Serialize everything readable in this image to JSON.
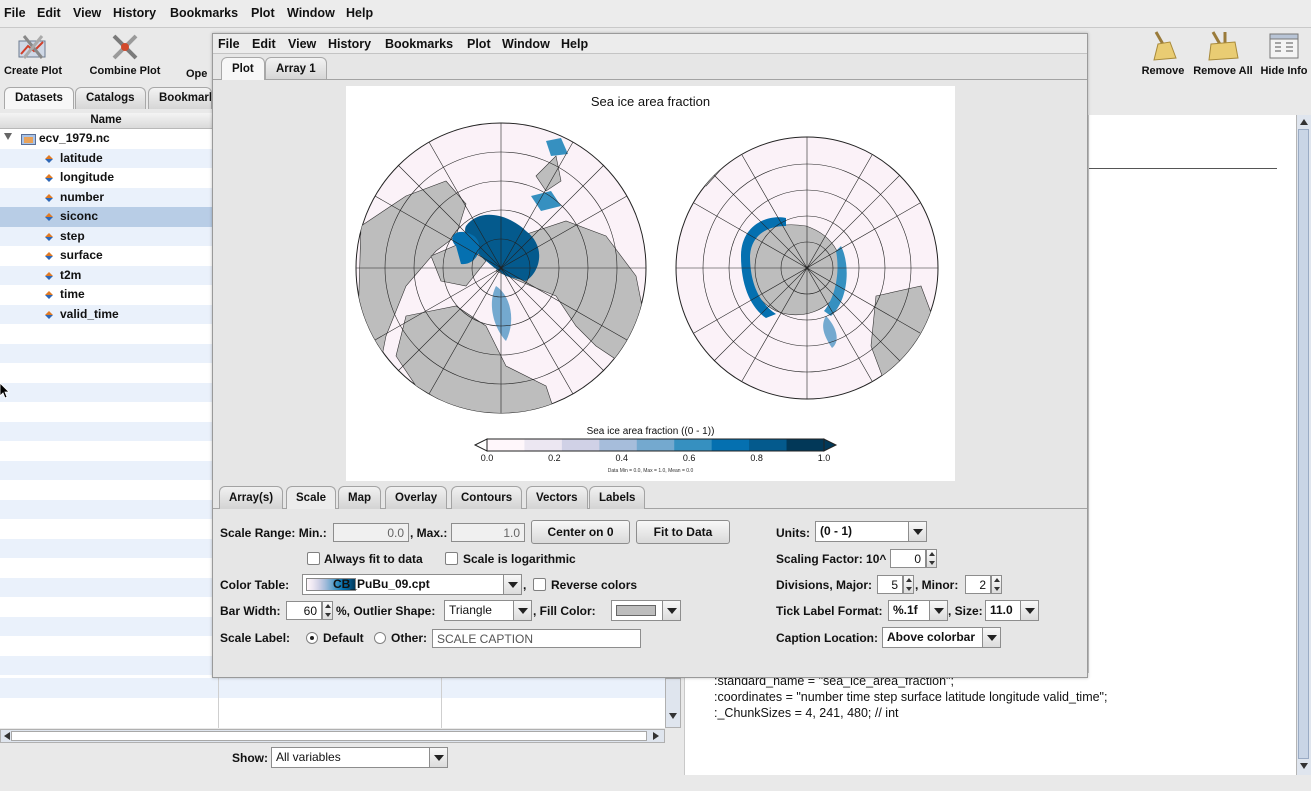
{
  "menubar": [
    "File",
    "Edit",
    "View",
    "History",
    "Bookmarks",
    "Plot",
    "Window",
    "Help"
  ],
  "toolbar": {
    "create_plot": "Create Plot",
    "combine_plot": "Combine Plot",
    "open": "Ope",
    "remove": "Remove",
    "remove_all": "Remove All",
    "hide_info": "Hide Info"
  },
  "left_tabs": [
    "Datasets",
    "Catalogs",
    "Bookmarks"
  ],
  "tree": {
    "column_header": "Name",
    "file": "ecv_1979.nc",
    "variables": [
      "latitude",
      "longitude",
      "number",
      "siconc",
      "step",
      "surface",
      "t2m",
      "time",
      "valid_time"
    ],
    "selected": "siconc"
  },
  "show": {
    "label": "Show:",
    "value": "All variables"
  },
  "info_lines": [
    ":standard_name = \"sea_ice_area_fraction\";",
    ":coordinates = \"number time step surface latitude longitude valid_time\";",
    ":_ChunkSizes = 4, 241, 480; // int"
  ],
  "plot_window": {
    "menubar": [
      "File",
      "Edit",
      "View",
      "History",
      "Bookmarks",
      "Plot",
      "Window",
      "Help"
    ],
    "tabs": [
      "Plot",
      "Array 1"
    ],
    "plot": {
      "title": "Sea ice area fraction",
      "colorbar_label": "Sea ice area fraction ((0 - 1))",
      "colorbar_ticks": [
        "0.0",
        "0.2",
        "0.4",
        "0.6",
        "0.8",
        "1.0"
      ],
      "colorbar_stats": "Data Min = 0.0, Max = 1.0, Mean = 0.0",
      "colors": [
        "#fff7fb",
        "#ece7f2",
        "#d0d1e6",
        "#a6bddb",
        "#74a9cf",
        "#3690c0",
        "#0570b0",
        "#045a8d",
        "#023858"
      ]
    },
    "bottom_tabs": [
      "Array(s)",
      "Scale",
      "Map",
      "Overlay",
      "Contours",
      "Vectors",
      "Labels"
    ],
    "scale": {
      "range_label": "Scale Range: Min.:",
      "min": "0.0",
      "max_label": ", Max.:",
      "max": "1.0",
      "center_btn": "Center on 0",
      "fit_btn": "Fit to Data",
      "always_fit": "Always fit to data",
      "logarithmic": "Scale is logarithmic",
      "color_table_label": "Color Table:",
      "color_table": "CB_PuBu_09.cpt",
      "comma": ",",
      "reverse": "Reverse colors",
      "bar_width_label": "Bar Width:",
      "bar_width": "60",
      "outlier_label": "%, Outlier Shape:",
      "outlier": "Triangle",
      "fill_label": ", Fill Color:",
      "scale_label_label": "Scale Label:",
      "default": "Default",
      "other": "Other:",
      "caption_placeholder": "SCALE CAPTION",
      "units_label": "Units:",
      "units": "(0 - 1)",
      "scaling_label": "Scaling Factor: 10^",
      "scaling": "0",
      "divisions_label": "Divisions, Major:",
      "major": "5",
      "minor_label": ", Minor:",
      "minor": "2",
      "tick_format_label": "Tick Label Format:",
      "tick_format": "%.1f",
      "size_label": ", Size:",
      "size": "11.0",
      "caption_loc_label": "Caption Location:",
      "caption_loc": "Above colorbar"
    }
  }
}
